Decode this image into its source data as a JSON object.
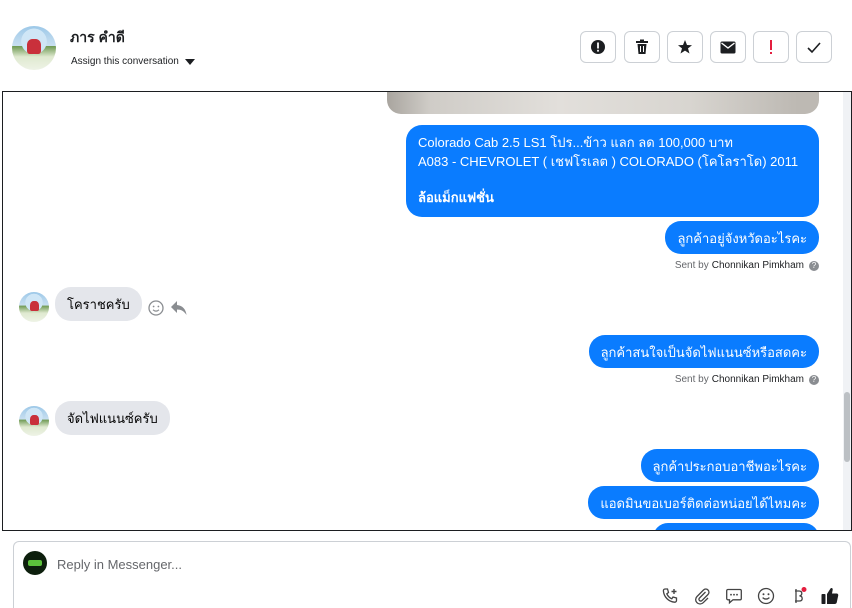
{
  "header": {
    "contact_name": "ภาร คำดี",
    "assign_label": "Assign this conversation",
    "actions": [
      "spam",
      "delete",
      "star",
      "mark-unread",
      "priority",
      "done"
    ]
  },
  "messages": {
    "product_line1": "Colorado Cab 2.5 LS1 โปร...ข้าว แลก ลด 100,000 บาท",
    "product_line2": "A083 - CHEVROLET ( เชฟโรเลต ) COLORADO (โคโลราโด) 2011",
    "product_line3": "ล้อแม็กแฟชั่น",
    "out1": "ลูกค้าอยู่จังหวัดอะไรคะ",
    "in1": "โคราชครับ",
    "out2": "ลูกค้าสนใจเป็นจัดไฟแนนซ์หรือสดคะ",
    "in2": "จัดไฟแนนซ์ครับ",
    "out3": "ลูกค้าประกอบอาชีพอะไรคะ",
    "out4": "แอดมินขอเบอร์ติดต่อหน่อยได้ไหมคะ",
    "sent_by_prefix": "Sent by",
    "sender_name": "Chonnikan Pimkham",
    "help_glyph": "?"
  },
  "composer": {
    "placeholder": "Reply in Messenger..."
  },
  "colors": {
    "bubble_out": "#0a7cff",
    "bubble_in": "#e4e6eb",
    "priority_red": "#e41e3f"
  }
}
